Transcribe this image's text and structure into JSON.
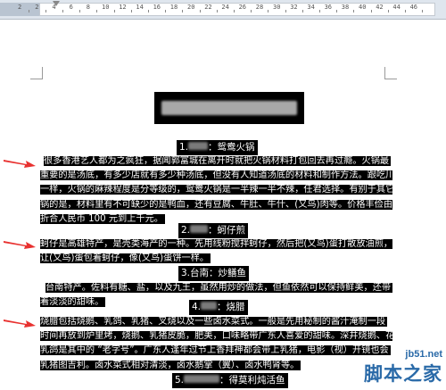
{
  "ruler": {
    "ticks": [
      "2",
      "2",
      "4",
      "6",
      "8",
      "10",
      "12",
      "14",
      "16",
      "18",
      "20",
      "22",
      "24",
      "26",
      "28",
      "30",
      "32",
      "34",
      "36",
      "38",
      "40",
      "42",
      "44",
      "46"
    ]
  },
  "document": {
    "section1": {
      "heading_prefix": "1.",
      "heading_suffix": "：鸳鸯火锅",
      "lines": [
        "很多香港艺人都为之疯狂，据闻郭富城在离开时就把火锅材料打包回去再过瘾。火锅最",
        "重要的是汤底，有多少店就有多少种汤底，但没有人知道汤底的材料和制作方法。跟吃川菜",
        "一样，火锅的麻辣程度是分等级的，鸳鸯火锅是一半辣一半不辣，任君选择。有别于其它火",
        "锅的是，材料里有不可缺少的是鸭血，还有豆腐、牛肚、牛什、(又鸟)肉等。价格丰俭由人，",
        "折合人民币 100 元到上千元。"
      ]
    },
    "section2": {
      "heading_prefix": "2.",
      "heading_suffix": "：蚵仔煎",
      "lines": [
        "蚵仔是高雄特产，是壳类海产的一种。先用线粉搅拌蚵仔，然后把(又鸟)蛋打散放油煎，",
        "让(又鸟)蛋包着蚵仔，像(又鸟)蛋饼一样。"
      ]
    },
    "section3": {
      "heading": "3.台南：炒鳝鱼",
      "lines": [
        "台南特产。佐料有糖、盐，以及九王，虽然用炒的做法，但鱼依然可以保持鲜美，还带",
        "着淡淡的甜味。"
      ]
    },
    "section4": {
      "heading_prefix": "4.",
      "heading_suffix": "：烧腊",
      "lines": [
        "烧腊包括烧鹅、乳鸽、乳猪、叉烧以及一些卤水菜式。一般是先用秘制的酱汁淹制一段",
        "时间再放到炉里烤，烧鹅、乳猪皮脆，肥美，口味略带广东人喜爱的甜味。深井烧鹅、花田",
        "乳鸽是其中的 “老字号”。广东人逢年过节上香拜神都会带上乳猪，电影（视）开镜也会",
        "乳猪图吉利。卤水菜式相对清淡，卤水鹅掌（翼）、卤水鸭肾等。"
      ]
    },
    "section5": {
      "heading_prefix": "5.",
      "heading_suffix": "：得莫利炖活鱼"
    }
  },
  "watermark": {
    "url": "jb51.net",
    "name": "脚本之家"
  },
  "colors": {
    "selection": "#000000",
    "arrow": "#e8312f",
    "watermark": "#2a6aa8"
  }
}
